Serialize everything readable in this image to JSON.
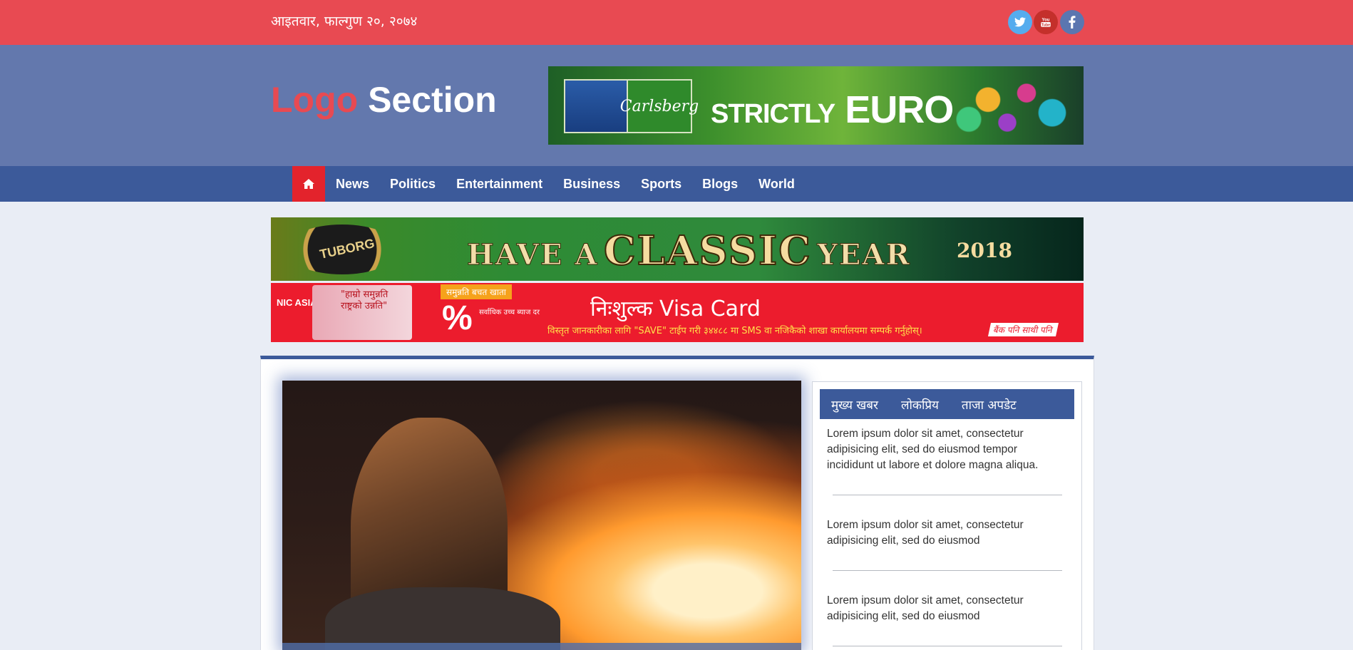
{
  "topbar": {
    "date": "आइतवार, फाल्गुण २०, २०७४",
    "social": [
      {
        "name": "twitter-icon",
        "glyph": "t"
      },
      {
        "name": "youtube-icon",
        "glyph": "You"
      },
      {
        "name": "facebook-icon",
        "glyph": "f"
      }
    ]
  },
  "header": {
    "logo_part1": "Logo",
    "logo_part2": "Section",
    "ad_top": {
      "brand": "Carlsberg",
      "tagline_small": "STRICTLY",
      "tagline_big": "EURO"
    }
  },
  "nav": {
    "home_icon": "home-icon",
    "items": [
      "News",
      "Politics",
      "Entertainment",
      "Business",
      "Sports",
      "Blogs",
      "World"
    ]
  },
  "ads": {
    "tuborg": {
      "brand": "TUBORG",
      "headline_a": "HAVE A",
      "headline_b": "CLASSIC",
      "headline_c": "YEAR",
      "year": "2018"
    },
    "nic": {
      "brand": "NIC ASIA",
      "quote": "\"हाम्रो समुन्नति राष्ट्रको उन्नति\"",
      "badge": "समुन्नति बचत खाता",
      "rate_sub": "सर्वाधिक उच्च ब्याज दर",
      "visa": "निःशुल्क Visa Card",
      "info": "विस्तृत जानकारीका लागि \"SAVE\" टाईप गरी ३४४८८ मा SMS वा नजिकैको शाखा कार्यालयमा सम्पर्क गर्नुहोस्।",
      "tag": "बैंक पनि साथी पनि"
    }
  },
  "sidebar": {
    "tabs": [
      "मुख्य खबर",
      "लोकप्रिय",
      "ताजा अपडेट"
    ],
    "items": [
      "Lorem ipsum dolor sit amet, consectetur adipisicing elit, sed do eiusmod tempor incididunt ut labore et dolore magna aliqua.",
      "Lorem ipsum dolor sit amet, consectetur adipisicing elit, sed do eiusmod",
      "Lorem ipsum dolor sit amet, consectetur adipisicing elit, sed do eiusmod"
    ]
  },
  "colors": {
    "topbar": "#e84a52",
    "header": "#6378ad",
    "nav": "#3c5a9a",
    "home_active": "#e3232c",
    "page_bg": "#e9edf5"
  }
}
